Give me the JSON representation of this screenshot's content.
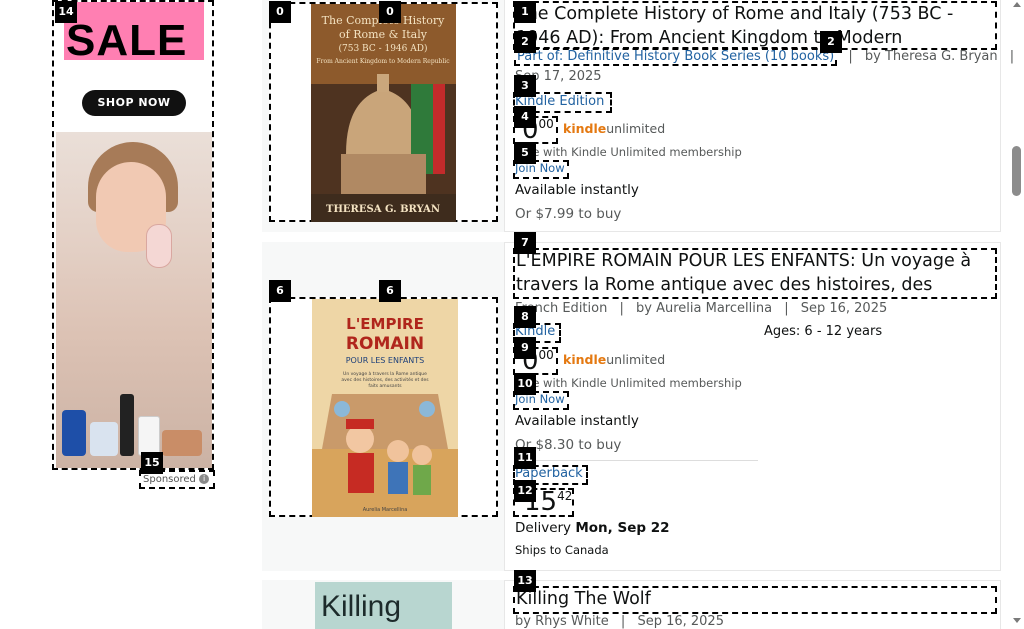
{
  "ad": {
    "sale": "SALE",
    "shop_now": "SHOP NOW",
    "sponsored": "Sponsored",
    "info_icon": "info-icon"
  },
  "tags": [
    "0",
    "0",
    "1",
    "2",
    "2",
    "3",
    "4",
    "5",
    "6",
    "6",
    "7",
    "8",
    "9",
    "10",
    "11",
    "12",
    "13",
    "14",
    "15"
  ],
  "results": [
    {
      "title": "The Complete History of Rome and Italy (753 BC - 1946 AD): From Ancient Kingdom to Modern Republic...",
      "series": "Part of: Definitive History Book Series (10 books)",
      "author_prefix": "by",
      "author": "Theresa G. Bryan",
      "date": "Sep 17, 2025",
      "format": "Kindle Edition",
      "price_whole": "0",
      "price_frac": "00",
      "ku_logo": "kindleunlimited",
      "ku_note": "Free with Kindle Unlimited membership",
      "join": "Join Now",
      "avail": "Available instantly",
      "or_buy": "Or $7.99 to buy",
      "cover_title": "The Complete History of Rome & Italy (753 BC - 1946 AD)",
      "cover_sub": "From Ancient Kingdom to Modern Republic",
      "cover_author": "THERESA G. BRYAN"
    },
    {
      "title": "L'EMPIRE ROMAIN POUR LES ENFANTS: Un voyage à travers la Rome antique avec des histoires, des activités ...",
      "edition": "French Edition",
      "author_prefix": "by",
      "author": "Aurelia Marcellina",
      "date": "Sep 16, 2025",
      "format": "Kindle",
      "ages": "Ages: 6 - 12 years",
      "price_whole": "0",
      "price_frac": "00",
      "ku_logo": "kindleunlimited",
      "ku_note": "Free with Kindle Unlimited membership",
      "join": "Join Now",
      "avail": "Available instantly",
      "or_buy": "Or $8.30 to buy",
      "format2": "Paperback",
      "price2_whole": "15",
      "price2_frac": "42",
      "delivery_label": "Delivery",
      "delivery_date": "Mon, Sep 22",
      "ships": "Ships to Canada",
      "cover_title": "L'EMPIRE ROMAIN",
      "cover_sub": "POUR LES ENFANTS",
      "cover_small": "Un voyage à travers la Rome antique avec des histoires, des activités et des faits amusants",
      "cover_author": "Aurelia Marcellina"
    },
    {
      "title": "Killing The Wolf",
      "author_prefix": "by",
      "author": "Rhys White",
      "date": "Sep 16, 2025",
      "cover_title": "Killing"
    }
  ],
  "separator": "|"
}
